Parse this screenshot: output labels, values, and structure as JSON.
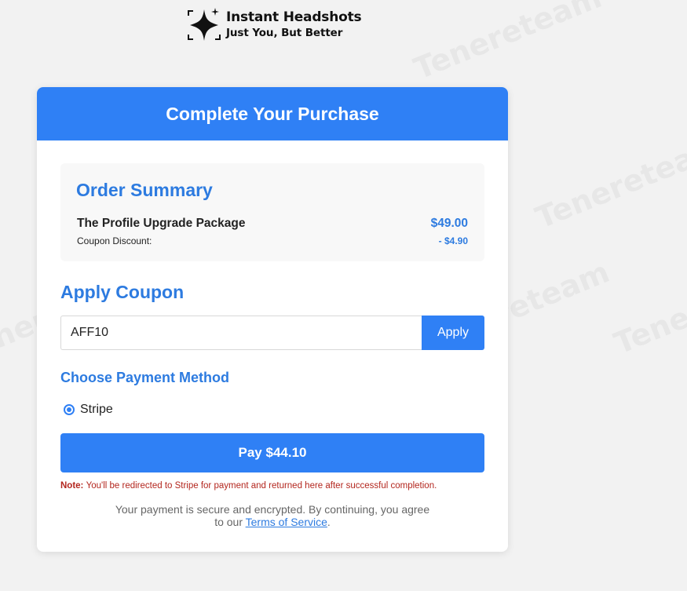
{
  "logo": {
    "name": "Instant Headshots",
    "tagline": "Just You, But Better"
  },
  "watermark": {
    "text": "Tenereteam"
  },
  "card": {
    "title": "Complete Your Purchase"
  },
  "order_summary": {
    "title": "Order Summary",
    "item_name": "The Profile Upgrade Package",
    "item_price": "$49.00",
    "coupon_label": "Coupon Discount:",
    "coupon_value": "- $4.90"
  },
  "coupon": {
    "title": "Apply Coupon",
    "input_value": "AFF10",
    "apply_label": "Apply"
  },
  "payment": {
    "title": "Choose Payment Method",
    "selected_option": "Stripe",
    "pay_label": "Pay $44.10"
  },
  "note": {
    "prefix": "Note:",
    "text": "You'll be redirected to Stripe for payment and returned here after successful completion."
  },
  "footer": {
    "secure_line1": "Your payment is secure and encrypted. By continuing, you agree",
    "secure_line2_prefix": "to our",
    "tos_link": "Terms of Service",
    "secure_line2_suffix": "."
  },
  "colors": {
    "accent": "#2f80f5",
    "heading": "#2d7be0",
    "note_red": "#b3261e",
    "background": "#f2f2f2"
  }
}
